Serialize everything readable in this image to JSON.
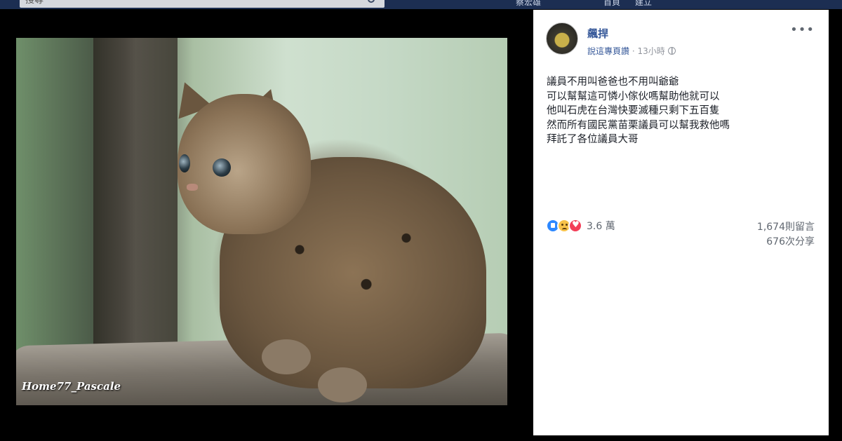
{
  "topbar": {
    "search_placeholder": "搜尋",
    "nav_items": [
      "蔡宏雄",
      "首頁",
      "建立"
    ]
  },
  "photo": {
    "watermark": "Home77_Pascale"
  },
  "post": {
    "author": "飆捍",
    "page_like_label": "說這專頁讚",
    "separator": " · ",
    "time": "13小時",
    "privacy_icon": "globe-icon",
    "more_icon_glyph": "•••",
    "body_lines": [
      "議員不用叫爸爸也不用叫爺爺",
      "可以幫幫這可憐小傢伙嗎幫助他就可以",
      "他叫石虎在台灣快要滅種只剩下五百隻",
      "然而所有國民黨苗栗議員可以幫我救他嗎",
      "拜託了各位議員大哥"
    ],
    "reactions": [
      "like-icon",
      "sad-icon",
      "love-icon"
    ],
    "reaction_count": "3.6 萬",
    "comment_count": "1,674則留言",
    "share_count": "676次分享"
  },
  "colors": {
    "link": "#365899",
    "meta": "#90949c",
    "like": "#2d88ff",
    "love": "#f33e58"
  }
}
